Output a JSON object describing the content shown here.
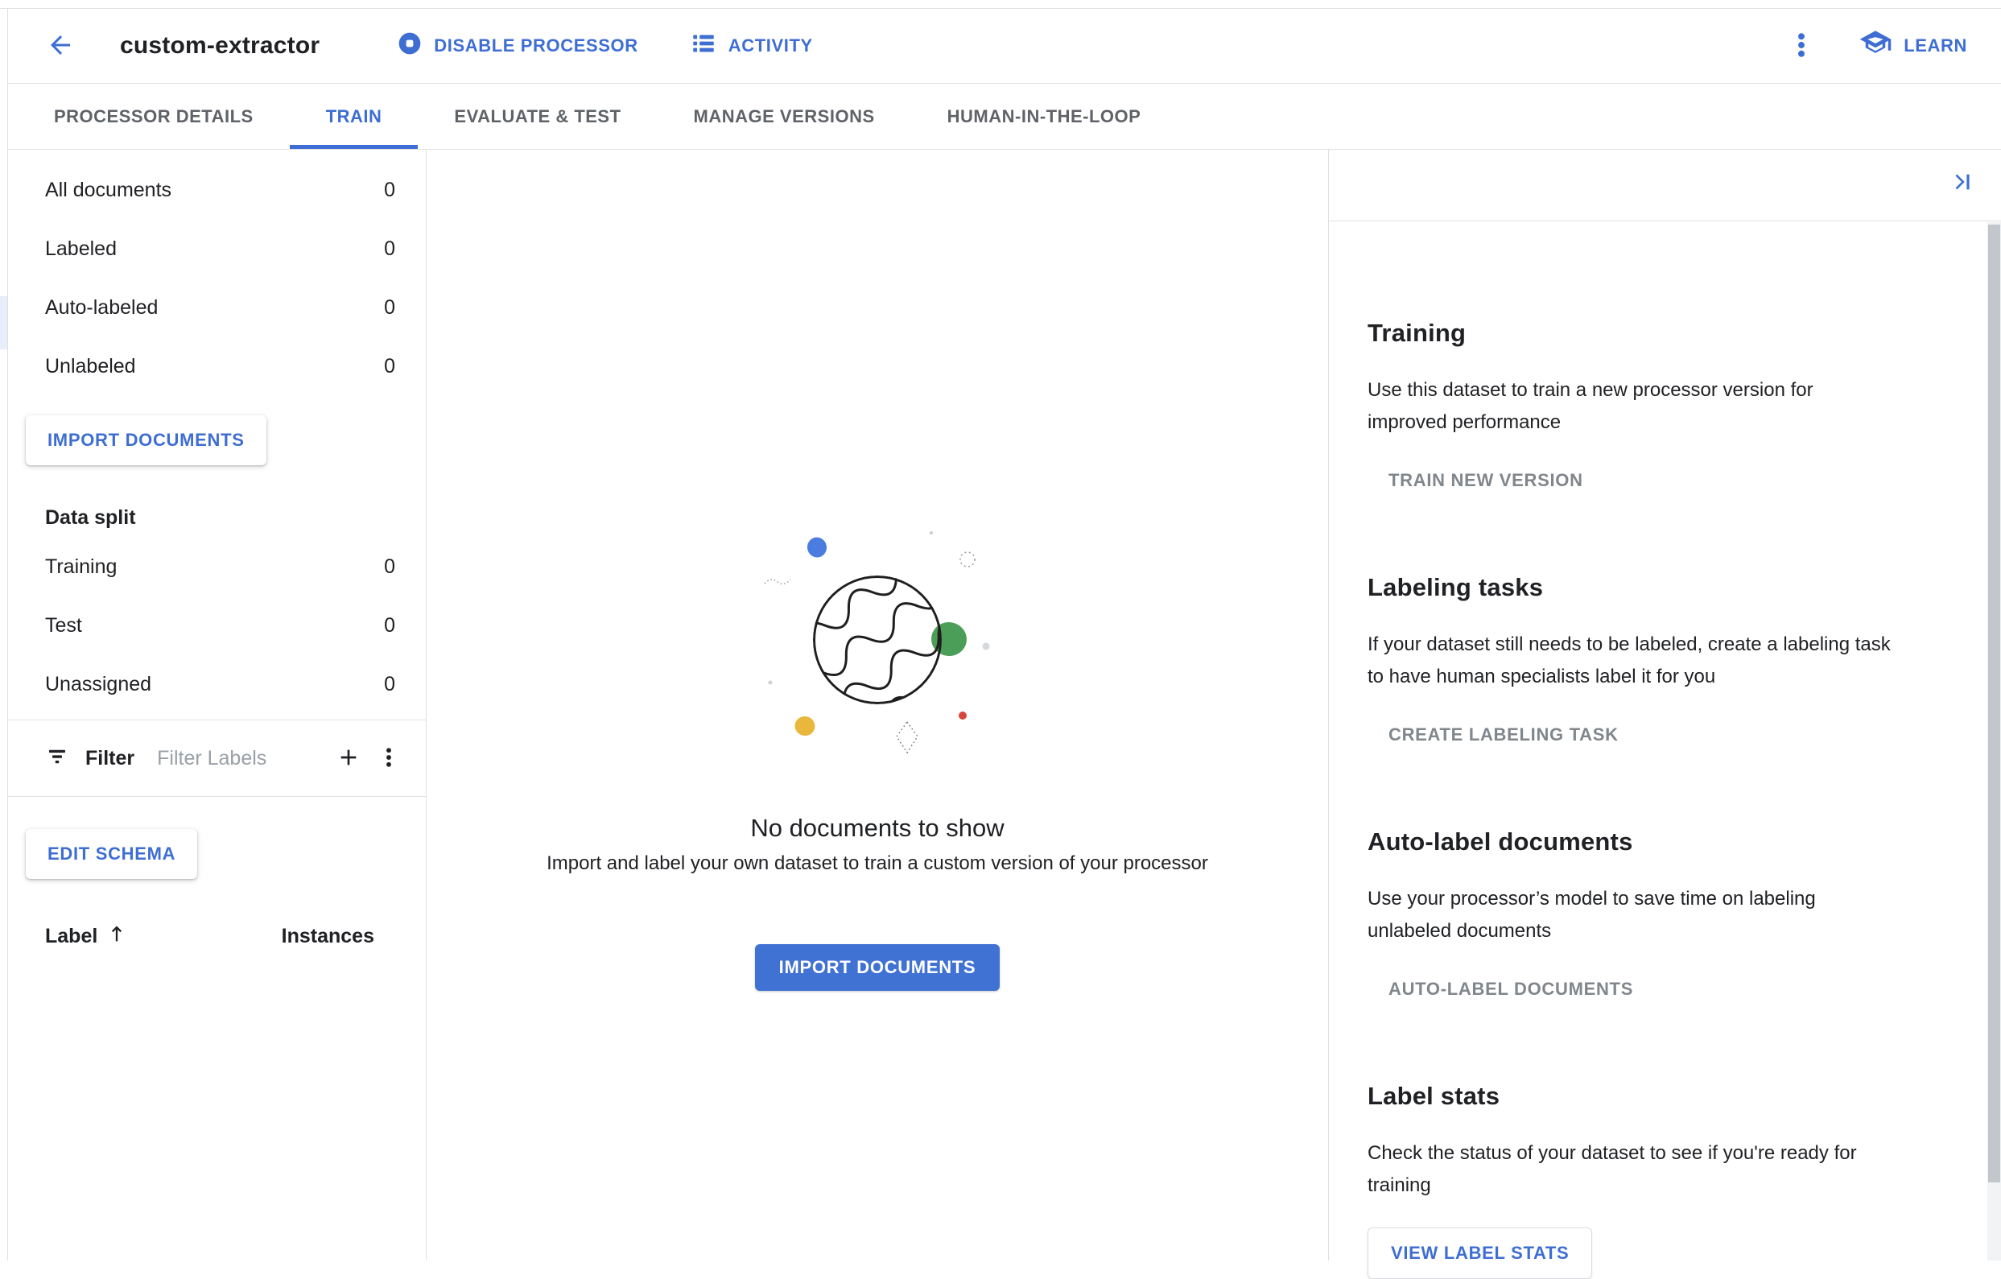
{
  "colors": {
    "accent": "#3e6ed3",
    "filled_button": "#4072d4",
    "text": "#202124",
    "muted_tab": "#5f6368",
    "disabled_action": "#80868b",
    "placeholder": "#9aa0a6",
    "border": "#e0e0e0",
    "nav_selected_strip": "#e8eefc",
    "blob_blue": "#4b7ce0",
    "blob_green": "#4b9e57",
    "blob_yellow": "#eab73d",
    "blob_red": "#d8453c"
  },
  "header": {
    "title": "custom-extractor",
    "disable_processor_label": "DISABLE PROCESSOR",
    "activity_label": "ACTIVITY",
    "learn_label": "LEARN"
  },
  "tabs": [
    {
      "label": "PROCESSOR DETAILS"
    },
    {
      "label": "TRAIN"
    },
    {
      "label": "EVALUATE & TEST"
    },
    {
      "label": "MANAGE VERSIONS"
    },
    {
      "label": "HUMAN-IN-THE-LOOP"
    }
  ],
  "sidebar": {
    "doc_counts": [
      {
        "label": "All documents",
        "count": "0"
      },
      {
        "label": "Labeled",
        "count": "0"
      },
      {
        "label": "Auto-labeled",
        "count": "0"
      },
      {
        "label": "Unlabeled",
        "count": "0"
      }
    ],
    "import_button": "IMPORT DOCUMENTS",
    "data_split_title": "Data split",
    "split_counts": [
      {
        "label": "Training",
        "count": "0"
      },
      {
        "label": "Test",
        "count": "0"
      },
      {
        "label": "Unassigned",
        "count": "0"
      }
    ],
    "filter": {
      "label": "Filter",
      "placeholder": "Filter Labels"
    },
    "edit_schema_button": "EDIT SCHEMA",
    "table": {
      "label_header": "Label",
      "instances_header": "Instances"
    }
  },
  "empty_state": {
    "title": "No documents to show",
    "subtitle": "Import and label your own dataset to train a custom version of your processor",
    "import_button": "IMPORT DOCUMENTS"
  },
  "right_panel": {
    "sections": [
      {
        "title": "Training",
        "body": "Use this dataset to train a new processor version for\nimproved performance",
        "action": "TRAIN NEW VERSION"
      },
      {
        "title": "Labeling tasks",
        "body": "If your dataset still needs to be labeled, create a labeling task\nto have human specialists label it for you",
        "action": "CREATE LABELING TASK"
      },
      {
        "title": "Auto-label documents",
        "body": "Use your processor’s model to save time on labeling\nunlabeled documents",
        "action": "AUTO-LABEL DOCUMENTS"
      },
      {
        "title": "Label stats",
        "body": "Check the status of your dataset to see if you're ready for\ntraining",
        "action": "VIEW LABEL STATS"
      }
    ]
  }
}
